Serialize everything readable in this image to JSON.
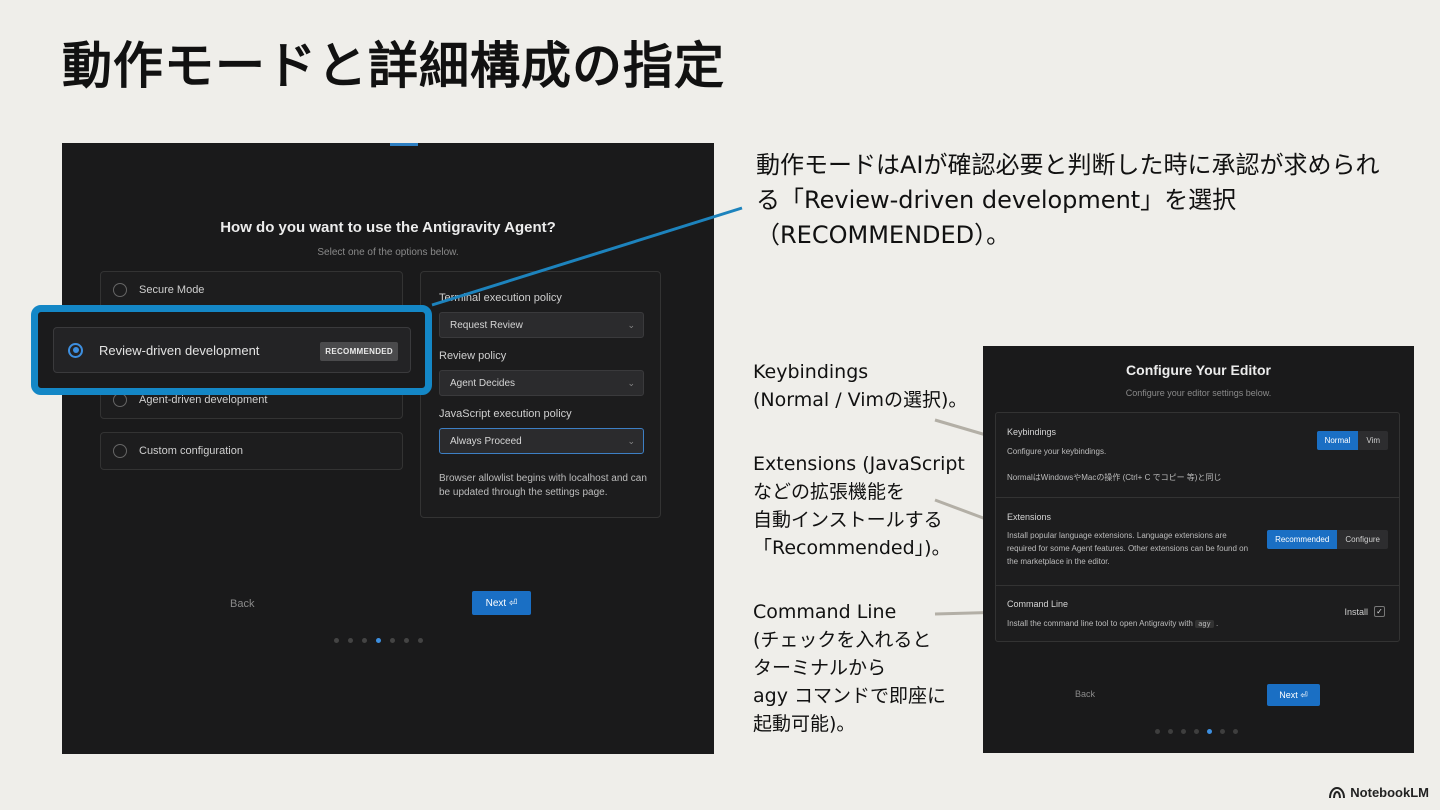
{
  "slide": {
    "title": "動作モードと詳細構成の指定",
    "brand": "NotebookLM",
    "brand_icon": "notebooklm-logo-icon"
  },
  "agent_panel": {
    "heading": "How do you want to use the Antigravity Agent?",
    "subheading": "Select one of the options below.",
    "options": [
      {
        "label": "Secure Mode",
        "selected": false
      },
      {
        "label": "Review-driven development",
        "selected": true,
        "badge": "RECOMMENDED"
      },
      {
        "label": "Agent-driven development",
        "selected": false
      },
      {
        "label": "Custom configuration",
        "selected": false
      }
    ],
    "policies": [
      {
        "label": "Terminal execution policy",
        "value": "Request Review"
      },
      {
        "label": "Review policy",
        "value": "Agent Decides"
      },
      {
        "label": "JavaScript execution policy",
        "value": "Always Proceed"
      }
    ],
    "note": "Browser allowlist begins with localhost and can be updated through the settings page.",
    "back_label": "Back",
    "next_label": "Next ⏎",
    "step_total": 7,
    "step_current": 4
  },
  "callouts": {
    "main": "動作モードはAIが確認必要と判断した時に承認が求められる「Review-driven development」を選択（RECOMMENDED）。",
    "keybindings": "Keybindings\n(Normal / Vimの選択)。",
    "extensions": "Extensions (JavaScript\nなどの拡張機能を\n自動インストールする\n「Recommended」)。",
    "command_line": "Command Line\n(チェックを入れると\nターミナルから\nagy コマンドで即座に\n起動可能)。"
  },
  "editor_panel": {
    "heading": "Configure Your Editor",
    "subheading": "Configure your editor settings below.",
    "keybindings": {
      "title": "Keybindings",
      "desc": "Configure your keybindings.",
      "note": "NormalはWindowsやMacの操作 (Ctrl+ C でコピー 等)と同じ",
      "options": [
        "Normal",
        "Vim"
      ],
      "selected": "Normal"
    },
    "extensions": {
      "title": "Extensions",
      "desc": "Install popular language extensions. Language extensions are required for some Agent features. Other extensions can be found on the marketplace in the editor.",
      "options": [
        "Recommended",
        "Configure"
      ],
      "selected": "Recommended"
    },
    "command_line": {
      "title": "Command Line",
      "desc_before": "Install the command line tool to open Antigravity with",
      "desc_code": "agy",
      "desc_after": ".",
      "install_label": "Install",
      "checked": true
    },
    "back_label": "Back",
    "next_label": "Next ⏎",
    "step_total": 7,
    "step_current": 5
  },
  "colors": {
    "highlight": "#1487c6",
    "accent": "#1a6fc4",
    "panel_bg": "#1a1a1b",
    "slide_bg": "#efeeea"
  }
}
